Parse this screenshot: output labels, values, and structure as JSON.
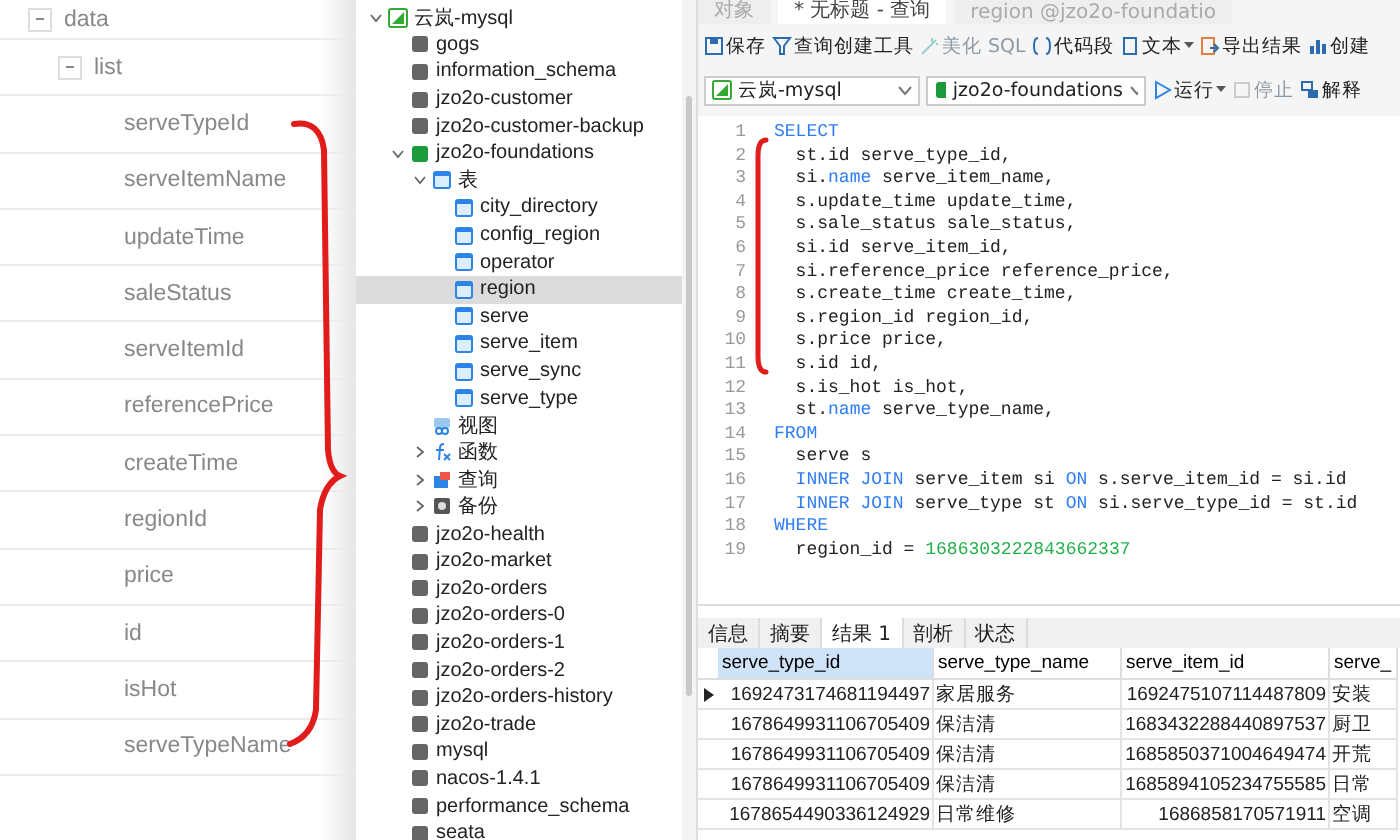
{
  "field_tree": {
    "label": "data",
    "expanded": true,
    "children": [
      {
        "label": "list",
        "expanded": true,
        "children": [
          {
            "label": "serveTypeId"
          },
          {
            "label": "serveItemName"
          },
          {
            "label": "updateTime"
          },
          {
            "label": "saleStatus"
          },
          {
            "label": "serveItemId"
          },
          {
            "label": "referencePrice"
          },
          {
            "label": "createTime"
          },
          {
            "label": "regionId"
          },
          {
            "label": "price"
          },
          {
            "label": "id"
          },
          {
            "label": "isHot"
          },
          {
            "label": "serveTypeName"
          }
        ]
      }
    ]
  },
  "db_tree": [
    {
      "label": "云岚-mysql",
      "kind": "connection",
      "expanded": true,
      "children": [
        {
          "label": "gogs",
          "kind": "database"
        },
        {
          "label": "information_schema",
          "kind": "database"
        },
        {
          "label": "jzo2o-customer",
          "kind": "database"
        },
        {
          "label": "jzo2o-customer-backup",
          "kind": "database"
        },
        {
          "label": "jzo2o-foundations",
          "kind": "database-open",
          "expanded": true,
          "children": [
            {
              "label": "表",
              "kind": "tables",
              "expanded": true,
              "children": [
                {
                  "label": "city_directory",
                  "kind": "table",
                  "selected": false
                },
                {
                  "label": "config_region",
                  "kind": "table",
                  "selected": false
                },
                {
                  "label": "operator",
                  "kind": "table",
                  "selected": false
                },
                {
                  "label": "region",
                  "kind": "table",
                  "selected": true
                },
                {
                  "label": "serve",
                  "kind": "table",
                  "selected": false
                },
                {
                  "label": "serve_item",
                  "kind": "table",
                  "selected": false
                },
                {
                  "label": "serve_sync",
                  "kind": "table",
                  "selected": false
                },
                {
                  "label": "serve_type",
                  "kind": "table",
                  "selected": false
                }
              ]
            },
            {
              "label": "视图",
              "kind": "views"
            },
            {
              "label": "函数",
              "kind": "functions",
              "expanded": false
            },
            {
              "label": "查询",
              "kind": "queries",
              "expanded": false
            },
            {
              "label": "备份",
              "kind": "backups",
              "expanded": false
            }
          ]
        },
        {
          "label": "jzo2o-health",
          "kind": "database"
        },
        {
          "label": "jzo2o-market",
          "kind": "database"
        },
        {
          "label": "jzo2o-orders",
          "kind": "database"
        },
        {
          "label": "jzo2o-orders-0",
          "kind": "database"
        },
        {
          "label": "jzo2o-orders-1",
          "kind": "database"
        },
        {
          "label": "jzo2o-orders-2",
          "kind": "database"
        },
        {
          "label": "jzo2o-orders-history",
          "kind": "database"
        },
        {
          "label": "jzo2o-trade",
          "kind": "database"
        },
        {
          "label": "mysql",
          "kind": "database"
        },
        {
          "label": "nacos-1.4.1",
          "kind": "database"
        },
        {
          "label": "performance_schema",
          "kind": "database"
        },
        {
          "label": "seata",
          "kind": "database"
        }
      ]
    }
  ],
  "editor_tabs": [
    {
      "label": "对象",
      "selected": false
    },
    {
      "label": "* 无标题 - 查询",
      "selected": true
    },
    {
      "label": "region @jzo2o-foundatio",
      "selected": false
    }
  ],
  "toolbar": [
    {
      "label": "保存",
      "kind": "save",
      "disabled": false,
      "dropdown": false
    },
    {
      "label": "查询创建工具",
      "kind": "builder",
      "disabled": false,
      "dropdown": false
    },
    {
      "label": "美化 SQL",
      "kind": "beautify",
      "disabled": true,
      "dropdown": false
    },
    {
      "label": "代码段",
      "kind": "snippet",
      "disabled": false,
      "dropdown": false
    },
    {
      "label": "文本",
      "kind": "text",
      "disabled": false,
      "dropdown": true
    },
    {
      "label": "导出结果",
      "kind": "export",
      "disabled": false,
      "dropdown": false
    },
    {
      "label": "创建",
      "kind": "chart",
      "disabled": false,
      "dropdown": false
    }
  ],
  "connection_select": {
    "value": "云岚-mysql"
  },
  "database_select": {
    "value": "jzo2o-foundations"
  },
  "run_bar": [
    {
      "label": "运行",
      "kind": "run",
      "disabled": false,
      "dropdown": true
    },
    {
      "label": "停止",
      "kind": "stop",
      "disabled": true,
      "dropdown": false
    },
    {
      "label": "解释",
      "kind": "explain",
      "disabled": false,
      "dropdown": false
    }
  ],
  "code_lines": [
    {
      "number": "1",
      "tokens": [
        {
          "text": "SELECT",
          "kind": "keyword"
        }
      ]
    },
    {
      "number": "2",
      "tokens": [
        {
          "text": "  st.id serve_type_id,",
          "kind": "plain"
        }
      ]
    },
    {
      "number": "3",
      "tokens": [
        {
          "text": "  si.",
          "kind": "plain"
        },
        {
          "text": "name",
          "kind": "keyword"
        },
        {
          "text": " serve_item_name,",
          "kind": "plain"
        }
      ]
    },
    {
      "number": "4",
      "tokens": [
        {
          "text": "  s.update_time update_time,",
          "kind": "plain"
        }
      ]
    },
    {
      "number": "5",
      "tokens": [
        {
          "text": "  s.sale_status sale_status,",
          "kind": "plain"
        }
      ]
    },
    {
      "number": "6",
      "tokens": [
        {
          "text": "  si.id serve_item_id,",
          "kind": "plain"
        }
      ]
    },
    {
      "number": "7",
      "tokens": [
        {
          "text": "  si.reference_price reference_price,",
          "kind": "plain"
        }
      ]
    },
    {
      "number": "8",
      "tokens": [
        {
          "text": "  s.create_time create_time,",
          "kind": "plain"
        }
      ]
    },
    {
      "number": "9",
      "tokens": [
        {
          "text": "  s.region_id region_id,",
          "kind": "plain"
        }
      ]
    },
    {
      "number": "10",
      "tokens": [
        {
          "text": "  s.price price,",
          "kind": "plain"
        }
      ]
    },
    {
      "number": "11",
      "tokens": [
        {
          "text": "  s.id id,",
          "kind": "plain"
        }
      ]
    },
    {
      "number": "12",
      "tokens": [
        {
          "text": "  s.is_hot is_hot,",
          "kind": "plain"
        }
      ]
    },
    {
      "number": "13",
      "tokens": [
        {
          "text": "  st.",
          "kind": "plain"
        },
        {
          "text": "name",
          "kind": "keyword"
        },
        {
          "text": " serve_type_name,",
          "kind": "plain"
        }
      ]
    },
    {
      "number": "14",
      "tokens": [
        {
          "text": "FROM",
          "kind": "keyword"
        }
      ]
    },
    {
      "number": "15",
      "tokens": [
        {
          "text": "  serve s",
          "kind": "plain"
        }
      ]
    },
    {
      "number": "16",
      "tokens": [
        {
          "text": "  INNER JOIN",
          "kind": "keyword"
        },
        {
          "text": " serve_item si ",
          "kind": "plain"
        },
        {
          "text": "ON",
          "kind": "keyword"
        },
        {
          "text": " s.serve_item_id = si.id",
          "kind": "plain"
        }
      ]
    },
    {
      "number": "17",
      "tokens": [
        {
          "text": "  INNER JOIN",
          "kind": "keyword"
        },
        {
          "text": " serve_type st ",
          "kind": "plain"
        },
        {
          "text": "ON",
          "kind": "keyword"
        },
        {
          "text": " si.serve_type_id = st.id",
          "kind": "plain"
        }
      ]
    },
    {
      "number": "18",
      "tokens": [
        {
          "text": "WHERE",
          "kind": "keyword"
        }
      ]
    },
    {
      "number": "19",
      "tokens": [
        {
          "text": "  region_id = ",
          "kind": "plain"
        },
        {
          "text": "1686303222843662337",
          "kind": "number"
        }
      ]
    }
  ],
  "result_tabs": [
    {
      "label": "信息",
      "selected": false
    },
    {
      "label": "摘要",
      "selected": false
    },
    {
      "label": "结果 1",
      "selected": true
    },
    {
      "label": "剖析",
      "selected": false
    },
    {
      "label": "状态",
      "selected": false
    }
  ],
  "result_table": {
    "columns": [
      {
        "label": "serve_type_id",
        "selected": true
      },
      {
        "label": "serve_type_name",
        "selected": false
      },
      {
        "label": "serve_item_id",
        "selected": false
      },
      {
        "label": "serve_",
        "selected": false
      }
    ],
    "rows": [
      {
        "current": true,
        "cells": [
          "1692473174681194497",
          "家居服务",
          "1692475107114487809",
          "安装"
        ]
      },
      {
        "current": false,
        "cells": [
          "1678649931106705409",
          "保洁清",
          "1683432288440897537",
          "厨卫"
        ]
      },
      {
        "current": false,
        "cells": [
          "1678649931106705409",
          "保洁清",
          "1685850371004649474",
          "开荒"
        ]
      },
      {
        "current": false,
        "cells": [
          "1678649931106705409",
          "保洁清",
          "1685894105234755585",
          "日常"
        ]
      },
      {
        "current": false,
        "cells": [
          "1678654490336124929",
          "日常维修",
          "1686858170571911",
          "空调"
        ]
      }
    ]
  }
}
